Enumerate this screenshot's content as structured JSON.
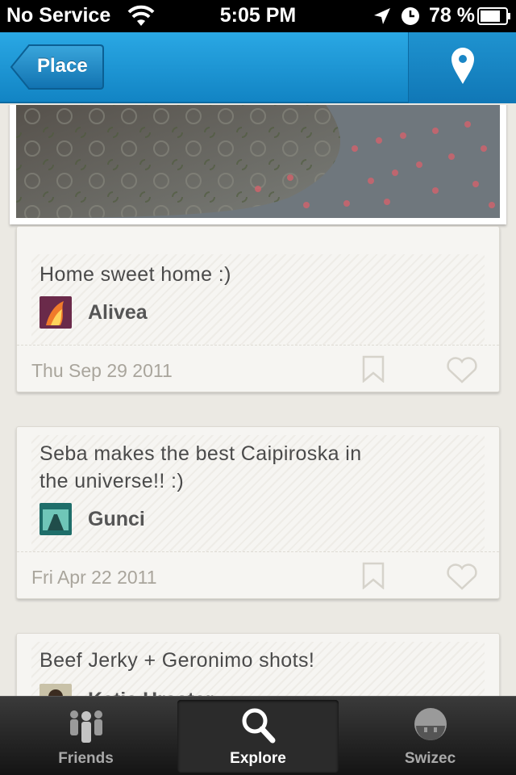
{
  "status_bar": {
    "carrier": "No Service",
    "time": "5:05 PM",
    "battery": "78 %"
  },
  "nav": {
    "back_label": "Place",
    "back_icon": "chevron-left",
    "right_icon": "map-pin-icon"
  },
  "posts": [
    {
      "caption": "Home sweet home :)",
      "author": "Alivea",
      "date": "Thu Sep 29 2011"
    },
    {
      "caption_line1": "Seba makes the best Caipiroska in",
      "caption_line2": "the universe!! :)",
      "author": "Gunci",
      "date": "Fri Apr 22 2011"
    },
    {
      "caption": "Beef Jerky + Geronimo shots!",
      "author": "Katia Hrastar"
    }
  ],
  "tabs": [
    {
      "label": "Friends",
      "icon": "people-icon",
      "active": false
    },
    {
      "label": "Explore",
      "icon": "search-icon",
      "active": true
    },
    {
      "label": "Swizec",
      "icon": "profile-icon",
      "active": false
    }
  ],
  "colors": {
    "nav_blue": "#1a95d6",
    "tab_bar": "#1e1e1e",
    "card_bg": "#f6f5f2"
  }
}
